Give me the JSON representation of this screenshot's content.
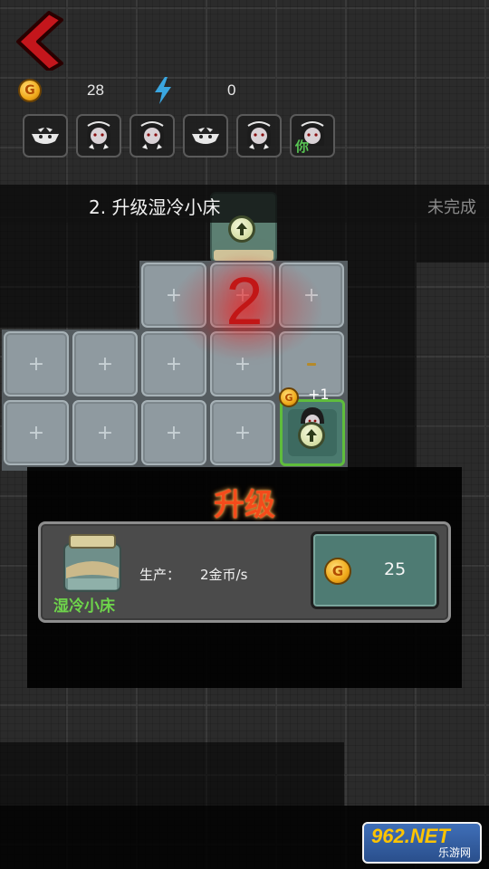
{
  "resources": {
    "coins": "28",
    "energy": "0",
    "coin_symbol": "G"
  },
  "slots": [
    {
      "icon": "ghost-face-icon"
    },
    {
      "icon": "ghost-girl-icon"
    },
    {
      "icon": "ghost-girl-icon"
    },
    {
      "icon": "ghost-face-icon"
    },
    {
      "icon": "ghost-girl-icon"
    },
    {
      "icon": "ghost-girl-icon",
      "tag": "你"
    }
  ],
  "task": {
    "text": "2. 升级湿冷小床",
    "status": "未完成"
  },
  "board": {
    "highlight_number": "2",
    "plus_sign": "+",
    "income_popup": "+1"
  },
  "upgrade_panel": {
    "title": "升级",
    "item_name": "湿冷小床",
    "production_label": "生产：",
    "production_value": "2金币/s",
    "price": "25"
  },
  "watermark": {
    "top": "962.NET",
    "bottom": "乐游网"
  },
  "colors": {
    "panel_title": "#f44b1b",
    "item_name": "#6ed44b",
    "buy_button": "#4e7b73",
    "highlight_number": "#c21616"
  }
}
